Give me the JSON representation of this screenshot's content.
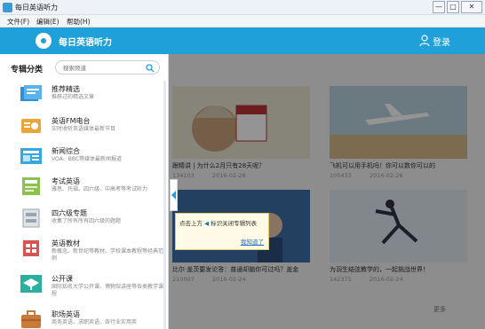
{
  "window": {
    "title": "每日英语听力",
    "buttons": [
      "—",
      "□",
      "✕"
    ]
  },
  "menu": [
    "文件(F)",
    "编辑(E)",
    "帮助(H)"
  ],
  "header": {
    "brand": "每日英语听力",
    "login": "登录",
    "accent": "#1fa0d8"
  },
  "sidebar": {
    "title": "专辑分类",
    "search_placeholder": "搜索频道",
    "items": [
      {
        "name": "推荐精选",
        "desc": "推荐过的精选文章",
        "icon": "featured-icon",
        "color": "#2f8fd8"
      },
      {
        "name": "英语FM电台",
        "desc": "实时收听英语媒体最新节目",
        "icon": "radio-icon",
        "color": "#e8a53a"
      },
      {
        "name": "新闻综合",
        "desc": "VOA、BBC等媒体最新闻报道",
        "icon": "news-icon",
        "color": "#37a7e0"
      },
      {
        "name": "考试英语",
        "desc": "雅思、托福、四六级、中高考等考试听力",
        "icon": "exam-icon",
        "color": "#8cc152"
      },
      {
        "name": "四六级专题",
        "desc": "收集了所有所有四六级的题题",
        "icon": "cet-icon",
        "color": "#b8c0c8"
      },
      {
        "name": "英语教材",
        "desc": "新概念、新世纪等教材、学校课本教程等经典范例",
        "icon": "textbook-icon",
        "color": "#d9534f"
      },
      {
        "name": "公开课",
        "desc": "国际知名大学公开课、博物馆讲座等各类教学课程",
        "icon": "course-icon",
        "color": "#2bb0a0"
      },
      {
        "name": "职场英语",
        "desc": "商务英语、求职英语、各行业实用英",
        "icon": "career-icon",
        "color": "#c87a3a"
      }
    ]
  },
  "cards": [
    {
      "title": "跟精讲 | 为什么2月只有28天呢？",
      "views": "134103",
      "date": "2016-02-28"
    },
    {
      "title": "飞机可以用手机吗！你可以数你可以的",
      "views": "105433",
      "date": "2016-02-26"
    },
    {
      "title": "比尔·盖茨要发论答：普通却脑你可过吗？盖金",
      "views": "210007",
      "date": "2016-02-24"
    },
    {
      "title": "为羽生结弦教学的，一起挑战世界！",
      "views": "142375",
      "date": "2016-02-24"
    }
  ],
  "more_label": "更多",
  "tooltip": {
    "text_prefix": "点击上方",
    "text_highlight": "",
    "text_suffix": "标识关闭专辑列表",
    "dismiss": "我知道了"
  }
}
